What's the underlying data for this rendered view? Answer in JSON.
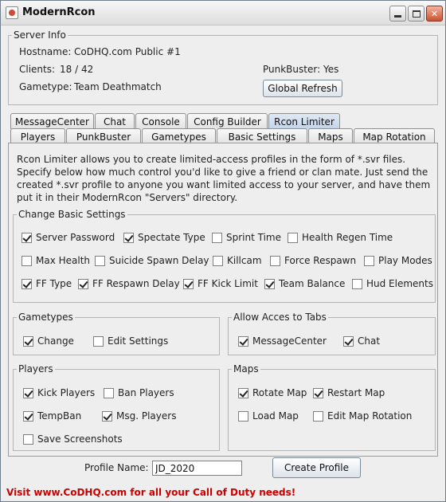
{
  "window": {
    "title": "ModernRcon"
  },
  "server_info": {
    "legend": "Server Info",
    "hostname_label": "Hostname:",
    "hostname_value": "CoDHQ.com Public #1",
    "clients_label": "Clients:",
    "clients_value": "18 / 42",
    "gametype_label": "Gametype:",
    "gametype_value": "Team Deathmatch",
    "punkbuster_label": "PunkBuster:",
    "punkbuster_value": "Yes",
    "refresh_button": "Global Refresh"
  },
  "tabs": {
    "row_top": [
      "MessageCenter",
      "Chat",
      "Console",
      "Config Builder",
      "Rcon Limiter"
    ],
    "row_bottom": [
      "Players",
      "PunkBuster",
      "Gametypes",
      "Basic Settings",
      "Maps",
      "Map Rotation"
    ],
    "active": "Rcon Limiter"
  },
  "rcon_limiter": {
    "description": "Rcon Limiter allows you to create limited-access profiles in the form of *.svr files. Specify below how much control you'd like to give a friend or clan mate. Just send the created *.svr profile to anyone you want limited access to your server, and have them put it in their ModernRcon \"Servers\" directory.",
    "basic_settings": {
      "legend": "Change Basic Settings",
      "options": [
        {
          "label": "Server Password",
          "checked": true
        },
        {
          "label": "Spectate Type",
          "checked": true
        },
        {
          "label": "Sprint Time",
          "checked": false
        },
        {
          "label": "Health Regen Time",
          "checked": false
        },
        {
          "label": "Max Health",
          "checked": false
        },
        {
          "label": "Suicide Spawn Delay",
          "checked": false
        },
        {
          "label": "Killcam",
          "checked": false
        },
        {
          "label": "Force Respawn",
          "checked": false
        },
        {
          "label": "Play Modes",
          "checked": false
        },
        {
          "label": "FF Type",
          "checked": true
        },
        {
          "label": "FF Respawn Delay",
          "checked": true
        },
        {
          "label": "FF Kick Limit",
          "checked": true
        },
        {
          "label": "Team Balance",
          "checked": true
        },
        {
          "label": "Hud Elements",
          "checked": false
        }
      ]
    },
    "gametypes": {
      "legend": "Gametypes",
      "options": [
        {
          "label": "Change",
          "checked": true
        },
        {
          "label": "Edit Settings",
          "checked": false
        }
      ]
    },
    "allow_tabs": {
      "legend": "Allow Acces to Tabs",
      "options": [
        {
          "label": "MessageCenter",
          "checked": true
        },
        {
          "label": "Chat",
          "checked": true
        }
      ]
    },
    "players": {
      "legend": "Players",
      "options": [
        {
          "label": "Kick Players",
          "checked": true
        },
        {
          "label": "Ban Players",
          "checked": false
        },
        {
          "label": "TempBan",
          "checked": true
        },
        {
          "label": "Msg. Players",
          "checked": true
        },
        {
          "label": "Save Screenshots",
          "checked": false
        }
      ]
    },
    "maps": {
      "legend": "Maps",
      "options": [
        {
          "label": "Rotate Map",
          "checked": true
        },
        {
          "label": "Restart Map",
          "checked": true
        },
        {
          "label": "Load Map",
          "checked": false
        },
        {
          "label": "Edit Map Rotation",
          "checked": false
        }
      ]
    }
  },
  "profile": {
    "label": "Profile Name:",
    "value": "JD_2020",
    "create_button": "Create Profile"
  },
  "footer": {
    "text": "Visit www.CoDHQ.com for all your Call of Duty needs!"
  }
}
